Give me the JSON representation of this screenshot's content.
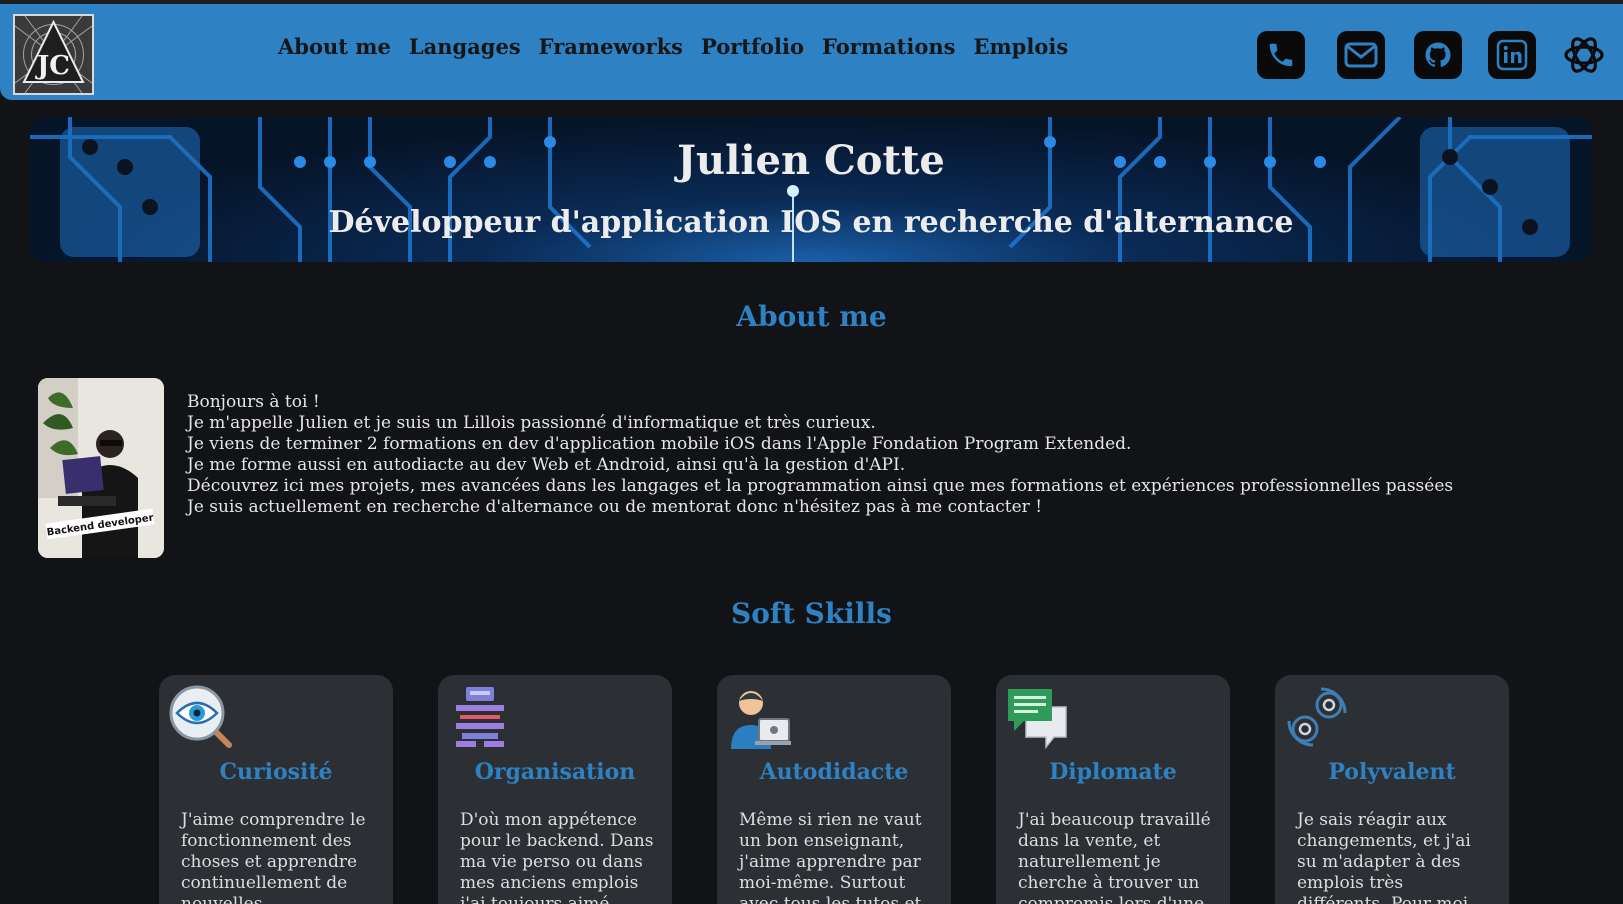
{
  "nav": {
    "logo_alt": "JC",
    "links": [
      {
        "label": "About me"
      },
      {
        "label": "Langages"
      },
      {
        "label": "Frameworks"
      },
      {
        "label": "Portfolio"
      },
      {
        "label": "Formations"
      },
      {
        "label": "Emplois"
      }
    ],
    "icons": [
      "phone-icon",
      "mail-icon",
      "github-icon",
      "linkedin-icon",
      "openai-icon"
    ]
  },
  "hero": {
    "title": "Julien Cotte",
    "subtitle": "Développeur d'application IOS en recherche d'alternance"
  },
  "about": {
    "title": "About me",
    "photo_caption": "Backend developer",
    "lines": [
      "Bonjours à toi !",
      "Je m'appelle Julien et je suis un Lillois passionné d'informatique et très curieux.",
      "Je viens de terminer 2 formations en dev d'application mobile iOS dans l'Apple Fondation Program Extended.",
      "Je me forme aussi en autodiacte au dev Web et Android, ainsi qu'à la gestion d'API.",
      "Découvrez ici mes projets, mes avancées dans les langages et la programmation ainsi que mes formations et expériences professionnelles passées",
      "Je suis actuellement en recherche d'alternance ou de mentorat donc n'hésitez pas à me contacter !"
    ]
  },
  "soft_skills": {
    "title": "Soft Skills",
    "cards": [
      {
        "title": "Curiosité",
        "icon": "eye-magnifier-icon",
        "text": "J'aime comprendre le fonctionnement des choses et apprendre continuellement de nouvelles"
      },
      {
        "title": "Organisation",
        "icon": "server-stack-icon",
        "text": "D'où mon appétence pour le backend. Dans ma vie perso ou dans mes anciens emplois j'ai toujours aimé"
      },
      {
        "title": "Autodidacte",
        "icon": "person-laptop-icon",
        "text": "Même si rien ne vaut un bon enseignant, j'aime apprendre par moi-même. Surtout avec tous les tutos et la"
      },
      {
        "title": "Diplomate",
        "icon": "chat-bubbles-icon",
        "text": "J'ai beaucoup travaillé dans la vente, et naturellement je cherche à trouver un compromis lors d'une"
      },
      {
        "title": "Polyvalent",
        "icon": "gears-cycle-icon",
        "text": "Je sais réagir aux changements, et j'ai su m'adapter à des emplois très différents. Pour moi c'est une"
      }
    ]
  },
  "colors": {
    "accent": "#2e82c4",
    "background": "#111316",
    "card": "#2c3035"
  }
}
